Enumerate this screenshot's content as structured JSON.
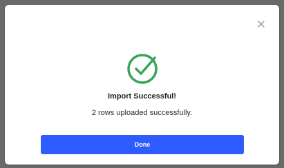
{
  "dialog": {
    "title": "Import Successful!",
    "message": "2 rows uploaded successfully.",
    "done_label": "Done",
    "close_icon": "close-icon",
    "status_icon": "check-circle-icon"
  },
  "colors": {
    "success": "#3aa55a",
    "primary": "#2f5cff",
    "backdrop": "#6a6a6a"
  }
}
